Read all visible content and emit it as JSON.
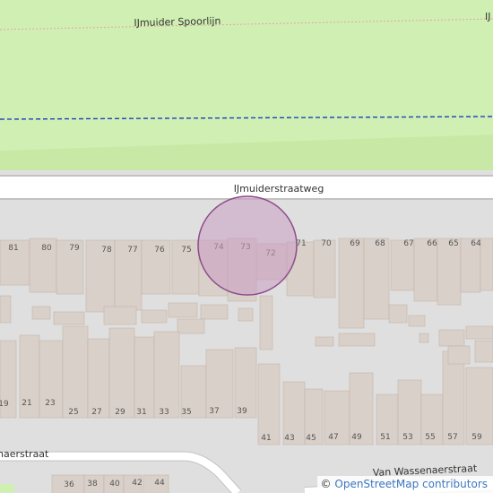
{
  "map": {
    "colors": {
      "background": "#e0dfdf",
      "rail_verge": "#c8e9a6",
      "park": "#d0f0b3",
      "road": "#ffffff",
      "road_casing": "#c4c2c0",
      "building": "#d9d0c9",
      "building_outline": "#c2b5aa",
      "rail_line": "#e9a0a6",
      "boundary": "#1f3fbf",
      "marker_fill": "#c99cc3",
      "marker_stroke": "#8d4c8a",
      "label": "#333333"
    },
    "streets": [
      {
        "id": "rail",
        "label": "IJmuider Spoorlijn"
      },
      {
        "id": "rail-right",
        "label": "IJ"
      },
      {
        "id": "main-road",
        "label": "IJmuiderstraatweg"
      },
      {
        "id": "south-road-left",
        "label": "naerstraat"
      },
      {
        "id": "south-road-right",
        "label": "Van Wassenaerstraat"
      }
    ],
    "house_numbers": {
      "north_row": [
        "81",
        "80",
        "79",
        "78",
        "77",
        "76",
        "75",
        "74",
        "73",
        "72",
        "71",
        "70",
        "69",
        "68",
        "67",
        "66",
        "65",
        "64"
      ],
      "middle_row": [
        "19",
        "21",
        "23",
        "25",
        "27",
        "29",
        "31",
        "33",
        "35",
        "37",
        "39"
      ],
      "south_row": [
        "41",
        "43",
        "45",
        "47",
        "49",
        "51",
        "53",
        "55",
        "57",
        "59"
      ],
      "bottom_row": [
        "36",
        "38",
        "40",
        "42",
        "44"
      ]
    },
    "marker": {
      "type": "circle-highlight",
      "label": "73"
    }
  },
  "attribution": {
    "copyright": "©",
    "provider": "OpenStreetMap contributors"
  }
}
